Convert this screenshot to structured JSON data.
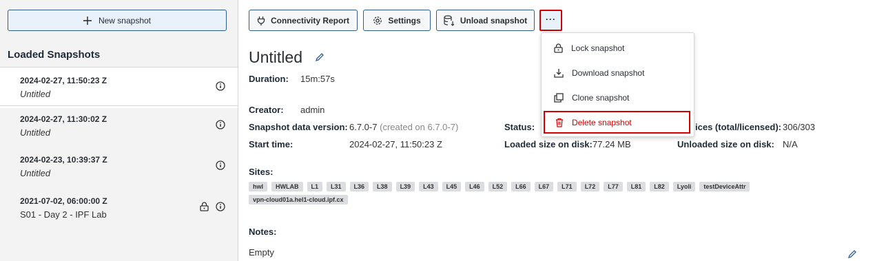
{
  "sidebar": {
    "new_snapshot_label": "New snapshot",
    "loaded_title": "Loaded Snapshots",
    "snapshots": [
      {
        "date": "2024-02-27, 11:50:23 Z",
        "name": "Untitled",
        "active": true,
        "locked": false
      },
      {
        "date": "2024-02-27, 11:30:02 Z",
        "name": "Untitled",
        "active": false,
        "locked": false
      },
      {
        "date": "2024-02-23, 10:39:37 Z",
        "name": "Untitled",
        "active": false,
        "locked": false
      },
      {
        "date": "2021-07-02, 06:00:00 Z",
        "name": "S01 - Day 2 - IPF Lab",
        "active": false,
        "locked": true
      }
    ]
  },
  "toolbar": {
    "connectivity_label": "Connectivity Report",
    "settings_label": "Settings",
    "unload_label": "Unload snapshot",
    "more_label": "···"
  },
  "menu": {
    "items": [
      {
        "label": "Lock snapshot",
        "icon": "lock-icon"
      },
      {
        "label": "Download snapshot",
        "icon": "download-icon"
      },
      {
        "label": "Clone snapshot",
        "icon": "clone-icon"
      },
      {
        "label": "Delete snapshot",
        "icon": "trash-icon"
      }
    ]
  },
  "details": {
    "title": "Untitled",
    "duration_label": "Duration:",
    "duration": "15m:57s",
    "creator_label": "Creator:",
    "creator": "admin",
    "version_label": "Snapshot data version:",
    "version": "6.7.0-7",
    "version_note": "(created on 6.7.0-7)",
    "status_label": "Status:",
    "devices_label": "ices (total/licensed):",
    "devices": "306/303",
    "start_label": "Start time:",
    "start": "2024-02-27, 11:50:23 Z",
    "loaded_size_label": "Loaded size on disk:",
    "loaded_size": "77.24 MB",
    "unloaded_size_label": "Unloaded size on disk:",
    "unloaded_size": "N/A",
    "sites_label": "Sites:",
    "sites": [
      "hwl",
      "HWLAB",
      "L1",
      "L31",
      "L36",
      "L38",
      "L39",
      "L43",
      "L45",
      "L46",
      "L52",
      "L66",
      "L67",
      "L71",
      "L72",
      "L77",
      "L81",
      "L82",
      "Lyoli",
      "testDeviceAttr",
      "vpn-cloud01a.hel1-cloud.ipf.cx"
    ],
    "notes_label": "Notes:",
    "notes": "Empty"
  },
  "colors": {
    "accent": "#2f5d8f",
    "danger": "#d40000"
  }
}
